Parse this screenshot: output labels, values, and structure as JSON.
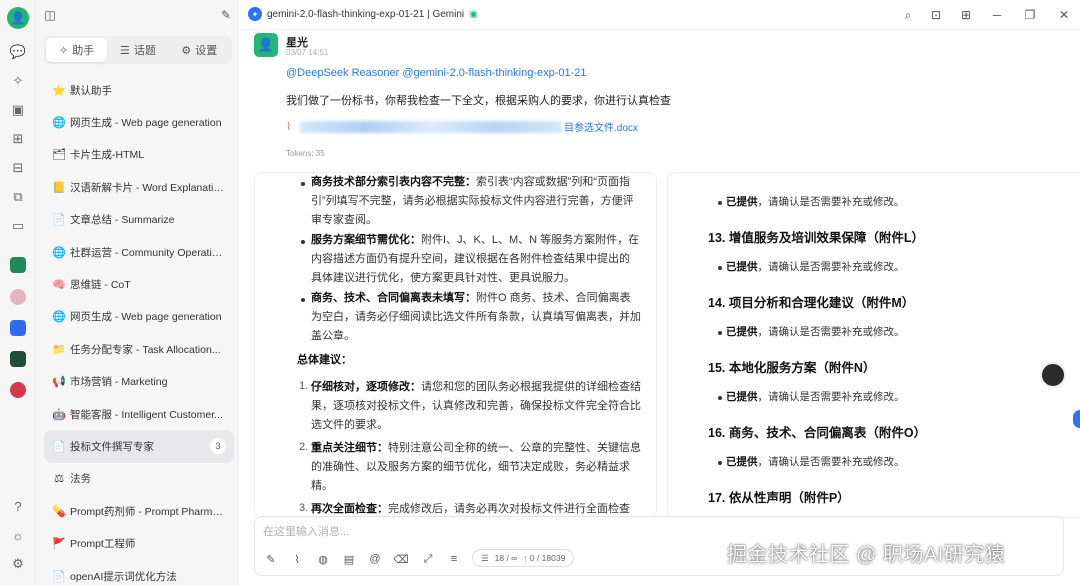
{
  "header": {
    "model_label": "gemini-2.0-flash-thinking-exp-01-21 | Gemini"
  },
  "sidebar": {
    "tabs": [
      {
        "label": "助手",
        "icon": "sparkle-icon",
        "active": true
      },
      {
        "label": "话题",
        "icon": "list-icon",
        "active": false
      },
      {
        "label": "设置",
        "icon": "gear-icon",
        "active": false
      }
    ],
    "assistants": [
      {
        "emoji": "⭐",
        "label": "默认助手"
      },
      {
        "emoji": "🌐",
        "label": "网页生成 - Web page generation"
      },
      {
        "emoji": "🗂",
        "label": "卡片生成-HTML"
      },
      {
        "emoji": "📒",
        "label": "汉语新解卡片 - Word Explanation..."
      },
      {
        "emoji": "📄",
        "label": "文章总结 - Summarize"
      },
      {
        "emoji": "🌐",
        "label": "社群运营 - Community Operations"
      },
      {
        "emoji": "🧠",
        "label": "思维链 - CoT"
      },
      {
        "emoji": "🌐",
        "label": "网页生成 - Web page generation"
      },
      {
        "emoji": "📁",
        "label": "任务分配专家 - Task Allocation..."
      },
      {
        "emoji": "📢",
        "label": "市场营销 - Marketing"
      },
      {
        "emoji": "🤖",
        "label": "智能客服 - Intelligent Customer..."
      },
      {
        "emoji": "📄",
        "label": "投标文件撰写专家",
        "count": "3",
        "active": true
      },
      {
        "emoji": "⚖",
        "label": "法务"
      },
      {
        "emoji": "💊",
        "label": "Prompt药剂师 - Prompt Pharmacist"
      },
      {
        "emoji": "🚩",
        "label": "Prompt工程师"
      },
      {
        "emoji": "📄",
        "label": "openAI提示词优化方法"
      }
    ]
  },
  "message": {
    "user_name": "星光",
    "time": "03/07 14:51",
    "mentions": "@DeepSeek Reasoner  @gemini-2.0-flash-thinking-exp-01-21",
    "body": "我们做了一份标书，你帮我检查一下全文，根据采购人的要求，你进行认真检查",
    "attachment": "目参选文件.docx",
    "tokens": "Tokens: 35"
  },
  "response_left": {
    "b1_bold": "商务技术部分索引表内容不完整：",
    "b1_line1": "索引表“内容或数据”列和“页面指",
    "b1_line2": "引”列填写不完整，请务必根据实际投标文件内容进行完善，方便评",
    "b1_line3": "审专家查阅。",
    "b2_bold": "服务方案细节需优化：",
    "b2_line1": "附件I、J、K、L、M、N 等服务方案附件，在",
    "b2_line2": "内容描述方面仍有提升空间，建议根据在各附件检查结果中提出的",
    "b2_line3": "具体建议进行优化，使方案更具针对性、更具说服力。",
    "b3_bold": "商务、技术、合同偏离表未填写：",
    "b3_line1": "附件O 商务、技术、合同偏离表",
    "b3_line2": "为空白，请务必仔细阅读比选文件所有条款，认真填写偏离表，并加",
    "b3_line3": "盖公章。",
    "summary_title": "总体建议：",
    "n1_label": "1.",
    "n1_bold": "仔细核对，逐项修改：",
    "n1_line1": "请您和您的团队务必根据我提供的详细检查结",
    "n1_line2": "果，逐项核对投标文件，认真修改和完善，确保投标文件完全符合比",
    "n1_line3": "选文件的要求。",
    "n2_label": "2.",
    "n2_bold": "重点关注细节：",
    "n2_line1": "特别注意公司全称的统一、公章的完整性、关键信息",
    "n2_line2": "的准确性、以及服务方案的细节优化，细节决定成败，务必精益求",
    "n2_line3": "精。",
    "n3_label": "3.",
    "n3_bold": "再次全面检查：",
    "n3_line1": "完成修改后，请务必再次对投标文件进行全面检查"
  },
  "response_right": {
    "provided_bold": "已提供",
    "provided_rest": "，请确认是否需要补充或修改。",
    "sections": [
      "13. 增值服务及培训效果保障（附件L）",
      "14. 项目分析和合理化建议（附件M）",
      "15. 本地化服务方案（附件N）",
      "16. 商务、技术、合同偏离表（附件O）",
      "17. 依从性声明（附件P）"
    ]
  },
  "composer": {
    "placeholder": "在这里输入消息...",
    "counter_left": "18 / ∞",
    "counter_right": "↑ 0 / 18039"
  },
  "watermark": "掘金技术社区 @ 职场AI研究猿"
}
